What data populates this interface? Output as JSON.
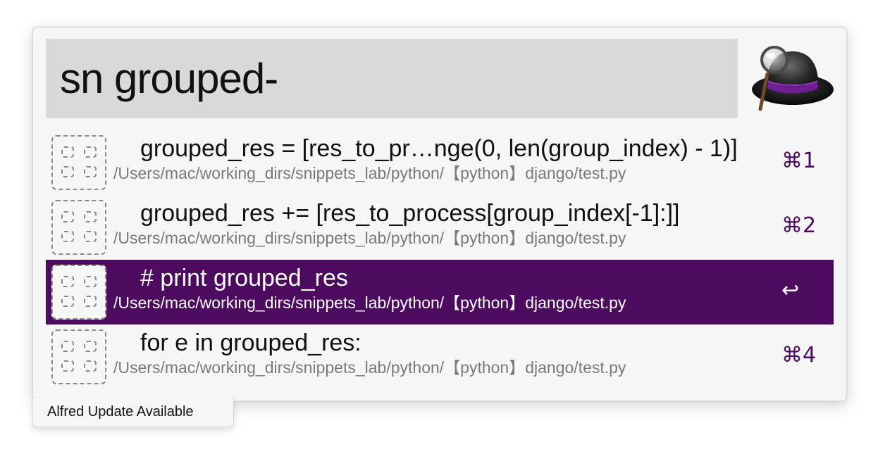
{
  "search": {
    "query": "sn grouped-"
  },
  "logo": {
    "icon": "alfred-hat-logo"
  },
  "results": [
    {
      "title": "grouped_res = [res_to_pr…nge(0, len(group_index) - 1)]",
      "subtitle": "/Users/mac/working_dirs/snippets_lab/python/【python】django/test.py",
      "shortcut": "⌘1",
      "icon": "snippet-icon",
      "selected": false
    },
    {
      "title": "grouped_res += [res_to_process[group_index[-1]:]]",
      "subtitle": "/Users/mac/working_dirs/snippets_lab/python/【python】django/test.py",
      "shortcut": "⌘2",
      "icon": "snippet-icon",
      "selected": false
    },
    {
      "title": "# print grouped_res",
      "subtitle": "/Users/mac/working_dirs/snippets_lab/python/【python】django/test.py",
      "shortcut": "↩",
      "icon": "snippet-icon",
      "selected": true
    },
    {
      "title": "for e in grouped_res:",
      "subtitle": "/Users/mac/working_dirs/snippets_lab/python/【python】django/test.py",
      "shortcut": "⌘4",
      "icon": "snippet-icon",
      "selected": false
    }
  ],
  "footer": {
    "update_label": "Alfred Update Available"
  },
  "colors": {
    "accent": "#4c0b5f",
    "search_bg": "#d9d9d9",
    "window_bg": "#f6f6f6"
  }
}
